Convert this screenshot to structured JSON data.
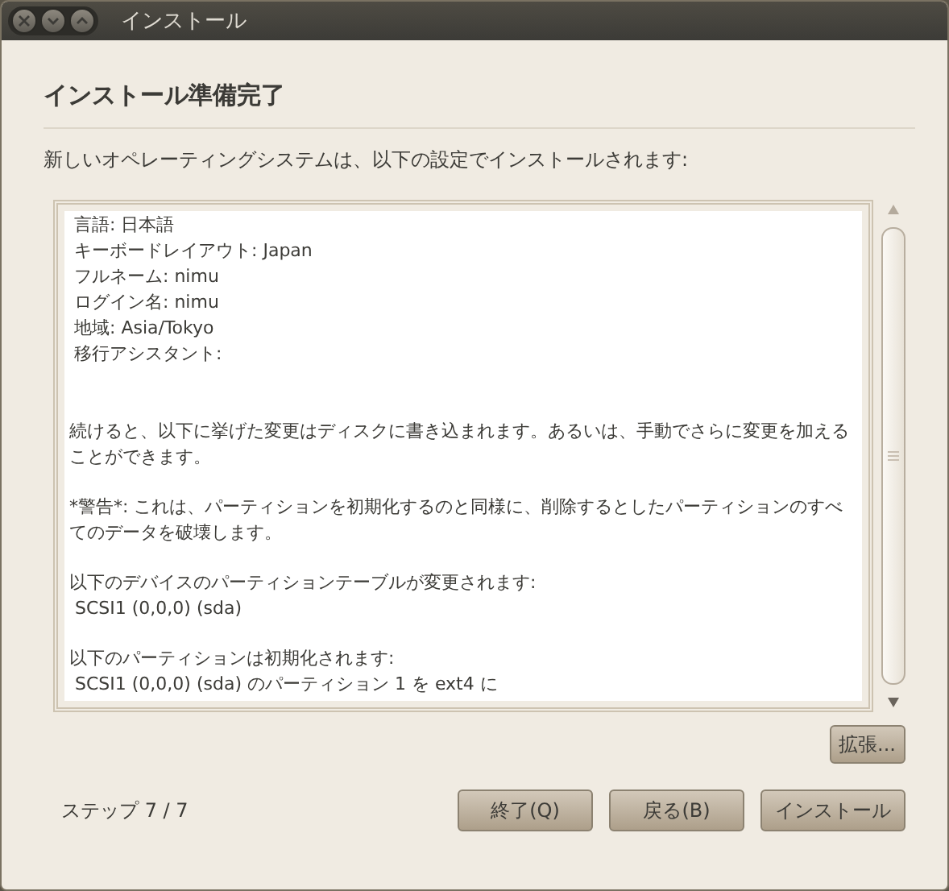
{
  "window": {
    "title": "インストール"
  },
  "heading": "インストール準備完了",
  "description": "新しいオペレーティングシステムは、以下の設定でインストールされます:",
  "summary": {
    "blocks": [
      {
        "kind": "settings",
        "lines": [
          "言語: 日本語",
          "キーボードレイアウト: Japan",
          "フルネーム: nimu",
          "ログイン名: nimu",
          "地域: Asia/Tokyo",
          "移行アシスタント:"
        ]
      },
      {
        "kind": "paragraph",
        "lines": [
          "続けると、以下に挙げた変更はディスクに書き込まれます。あるいは、手動でさらに変更を加えることができます。"
        ]
      },
      {
        "kind": "paragraph",
        "lines": [
          "*警告*: これは、パーティションを初期化するのと同様に、削除するとしたパーティションのすべてのデータを破壊します。"
        ]
      },
      {
        "kind": "paragraph",
        "lines": [
          "以下のデバイスのパーティションテーブルが変更されます:",
          " SCSI1 (0,0,0) (sda)"
        ]
      },
      {
        "kind": "paragraph",
        "lines": [
          "以下のパーティションは初期化されます:",
          " SCSI1 (0,0,0) (sda) のパーティション 1 を ext4 に"
        ]
      }
    ]
  },
  "advanced_button": "拡張...",
  "step": "ステップ 7 / 7",
  "buttons": [
    "終了(Q)",
    "戻る(B)",
    "インストール"
  ]
}
